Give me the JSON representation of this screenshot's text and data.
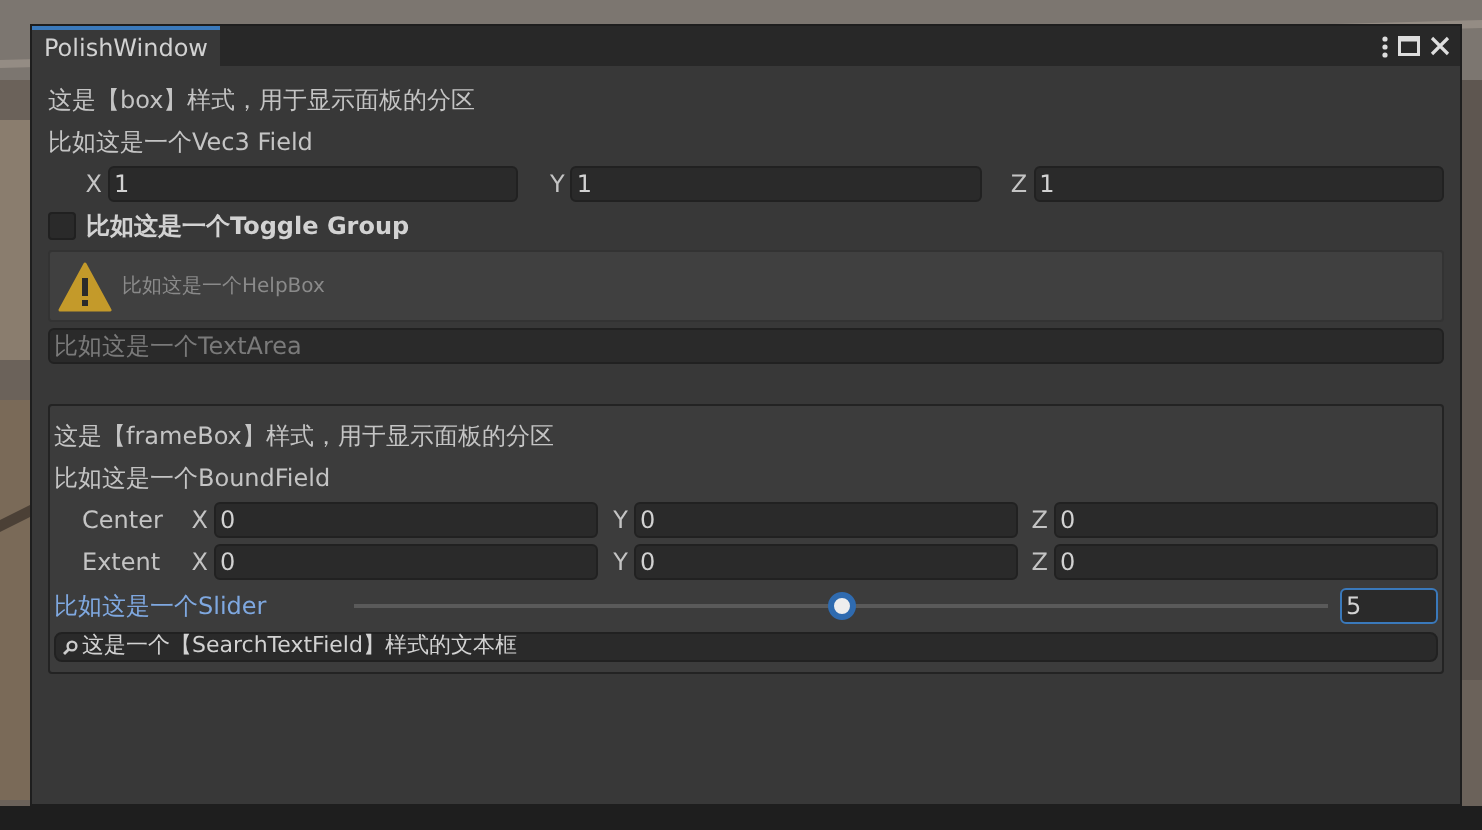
{
  "window": {
    "title": "PolishWindow"
  },
  "box": {
    "title": "这是【box】样式，用于显示面板的分区",
    "vec3_label": "比如这是一个Vec3 Field",
    "vec3": [
      {
        "axis": "X",
        "value": "1"
      },
      {
        "axis": "Y",
        "value": "1"
      },
      {
        "axis": "Z",
        "value": "1"
      }
    ],
    "toggle": {
      "label": "比如这是一个Toggle Group",
      "checked": false
    },
    "helpbox": {
      "text": "比如这是一个HelpBox"
    },
    "textarea": {
      "placeholder": "比如这是一个TextArea"
    }
  },
  "frame_box": {
    "title": "这是【frameBox】样式，用于显示面板的分区",
    "bound_label": "比如这是一个BoundField",
    "rows": [
      {
        "label": "Center",
        "fields": [
          {
            "axis": "X",
            "value": "0"
          },
          {
            "axis": "Y",
            "value": "0"
          },
          {
            "axis": "Z",
            "value": "0"
          }
        ]
      },
      {
        "label": "Extent",
        "fields": [
          {
            "axis": "X",
            "value": "0"
          },
          {
            "axis": "Y",
            "value": "0"
          },
          {
            "axis": "Z",
            "value": "0"
          }
        ]
      }
    ],
    "slider": {
      "label": "比如这是一个Slider",
      "level": 0.5,
      "value": "5"
    },
    "search": {
      "value": "这是一个【SearchTextField】样式的文本框"
    }
  }
}
